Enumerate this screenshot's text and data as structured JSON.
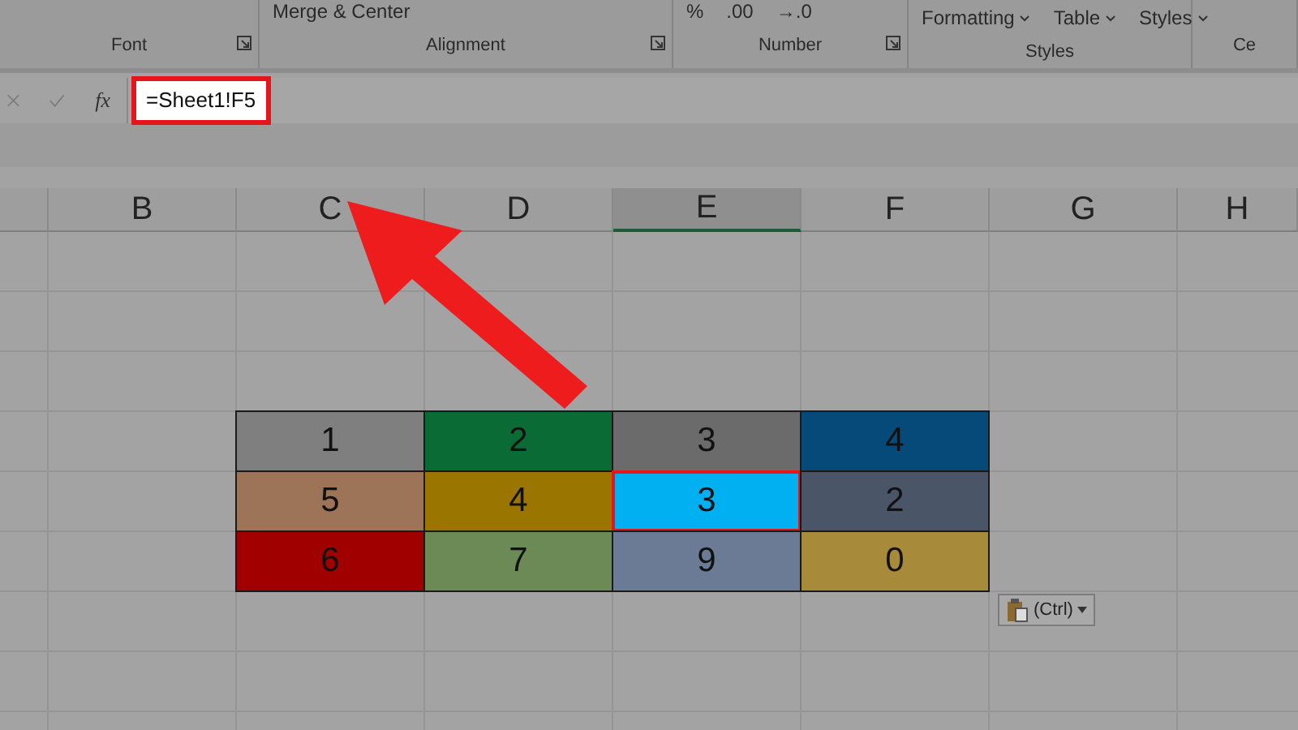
{
  "ribbon": {
    "groups": [
      {
        "label": "Font",
        "launcher": true
      },
      {
        "label": "Alignment",
        "launcher": true,
        "commands": [
          {
            "kind": "button",
            "label": "Merge & Center"
          }
        ]
      },
      {
        "label": "Number",
        "launcher": true,
        "commands": [
          {
            "kind": "button",
            "label": "%"
          },
          {
            "kind": "button",
            "label": ".00"
          },
          {
            "kind": "button",
            "label": "→.0"
          }
        ]
      },
      {
        "label": "Styles",
        "launcher": false,
        "commands": [
          {
            "kind": "dropdown",
            "label": "Formatting"
          },
          {
            "kind": "dropdown",
            "label": "Table"
          },
          {
            "kind": "dropdown",
            "label": "Styles"
          }
        ]
      },
      {
        "label": "Ce",
        "launcher": false
      }
    ]
  },
  "formula_bar": {
    "fx_label": "fx",
    "value": "=Sheet1!F5",
    "highlighted": true
  },
  "columns": [
    {
      "label": "B",
      "selected": false
    },
    {
      "label": "C",
      "selected": false
    },
    {
      "label": "D",
      "selected": false
    },
    {
      "label": "E",
      "selected": true
    },
    {
      "label": "F",
      "selected": false
    },
    {
      "label": "G",
      "selected": false
    },
    {
      "label": "H",
      "selected": false
    }
  ],
  "table": {
    "rows": [
      [
        {
          "value": "1",
          "color": "#7f7f7f",
          "selected": false
        },
        {
          "value": "2",
          "color": "#0b6b35",
          "selected": false
        },
        {
          "value": "3",
          "color": "#6b6b6b",
          "selected": false
        },
        {
          "value": "4",
          "color": "#064a7a",
          "selected": false
        }
      ],
      [
        {
          "value": "5",
          "color": "#9e7459",
          "selected": false
        },
        {
          "value": "4",
          "color": "#9a7600",
          "selected": false
        },
        {
          "value": "3",
          "color": "#00b0f0",
          "selected": true
        },
        {
          "value": "2",
          "color": "#4a5568",
          "selected": false
        }
      ],
      [
        {
          "value": "6",
          "color": "#a00000",
          "selected": false
        },
        {
          "value": "7",
          "color": "#6b8a55",
          "selected": false
        },
        {
          "value": "9",
          "color": "#6c7b95",
          "selected": false
        },
        {
          "value": "0",
          "color": "#a88b3a",
          "selected": false
        }
      ]
    ]
  },
  "paste_options": {
    "label": "(Ctrl)"
  }
}
